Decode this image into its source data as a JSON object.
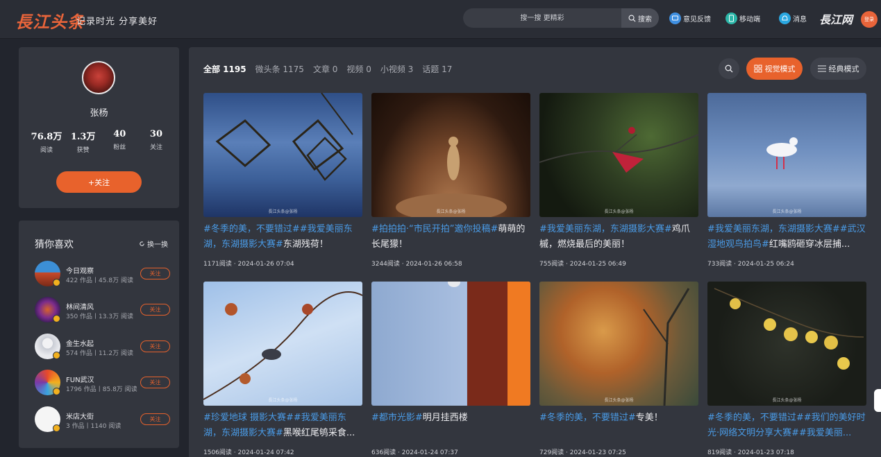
{
  "header": {
    "logo": "長江头条",
    "slogan": "记录时光 分享美好",
    "search_placeholder": "搜一搜 更精彩",
    "search_btn": "搜索",
    "feedback": "意见反馈",
    "mobile": "移动端",
    "messages": "消息",
    "brand2": "長江网",
    "login": "登录"
  },
  "profile": {
    "name": "张杨",
    "follow_btn": "+关注",
    "stats": [
      {
        "value": "76.8万",
        "label": "阅读"
      },
      {
        "value": "1.3万",
        "label": "获赞"
      },
      {
        "value": "40",
        "label": "粉丝"
      },
      {
        "value": "30",
        "label": "关注"
      }
    ]
  },
  "recommend": {
    "title": "猜你喜欢",
    "refresh": "换一换",
    "follow_label": "关注",
    "items": [
      {
        "name": "今日观察",
        "meta": "422 作品丨45.8万 阅读"
      },
      {
        "name": "林间清风",
        "meta": "350 作品丨13.3万 阅读"
      },
      {
        "name": "金生水起",
        "meta": "574 作品丨11.2万 阅读"
      },
      {
        "name": "FUN武汉",
        "meta": "1796 作品丨85.8万 阅读"
      },
      {
        "name": "米店大街",
        "meta": "3 作品丨1140 阅读"
      }
    ]
  },
  "tabs": [
    {
      "label": "全部 1195"
    },
    {
      "label": "微头条 1175"
    },
    {
      "label": "文章 0"
    },
    {
      "label": "视频 0"
    },
    {
      "label": "小视频 3"
    },
    {
      "label": "话题 17"
    }
  ],
  "view": {
    "visual": "视觉模式",
    "classic": "经典模式"
  },
  "cards": [
    {
      "tag": "#冬季的美，不要错过##我爱美丽东湖，东湖摄影大赛#",
      "title": "东湖残荷！",
      "meta": "1171阅读 · 2024-01-26 07:04",
      "watermark": "長江头条@张杨"
    },
    {
      "tag": "#拍拍拍·“市民开拍”邀你投稿#",
      "title": "萌萌的长尾獴！",
      "meta": "3244阅读 · 2024-01-26 06:58",
      "watermark": "長江头条@张杨"
    },
    {
      "tag": "#我爱美丽东湖，东湖摄影大赛#",
      "title": "鸡爪槭，燃烧最后的美丽！",
      "meta": "755阅读 · 2024-01-25 06:49",
      "watermark": "長江头条@张杨"
    },
    {
      "tag": "#我爱美丽东湖，东湖摄影大赛##武汉湿地观鸟拍鸟#",
      "title": "红嘴鸥砸穿冰层捕...",
      "meta": "733阅读 · 2024-01-25 06:24",
      "watermark": "長江头条@张杨"
    },
    {
      "tag": "#珍爱地球 摄影大赛##我爱美丽东湖，东湖摄影大赛#",
      "title": "黑喉红尾鸲采食...",
      "meta": "1506阅读 · 2024-01-24 07:42",
      "watermark": "長江头条@张杨"
    },
    {
      "tag": "#都市光影#",
      "title": "明月挂西楼",
      "meta": "636阅读 · 2024-01-24 07:37",
      "watermark": ""
    },
    {
      "tag": "#冬季的美，不要错过#",
      "title": "专美！",
      "meta": "729阅读 · 2024-01-23 07:25",
      "watermark": "長江头条@张杨"
    },
    {
      "tag": "#冬季的美，不要错过##我们的美好时光·网络文明分享大赛##我爱美丽...",
      "title": "",
      "meta": "819阅读 · 2024-01-23 07:18",
      "watermark": "長江头条@张杨"
    }
  ]
}
